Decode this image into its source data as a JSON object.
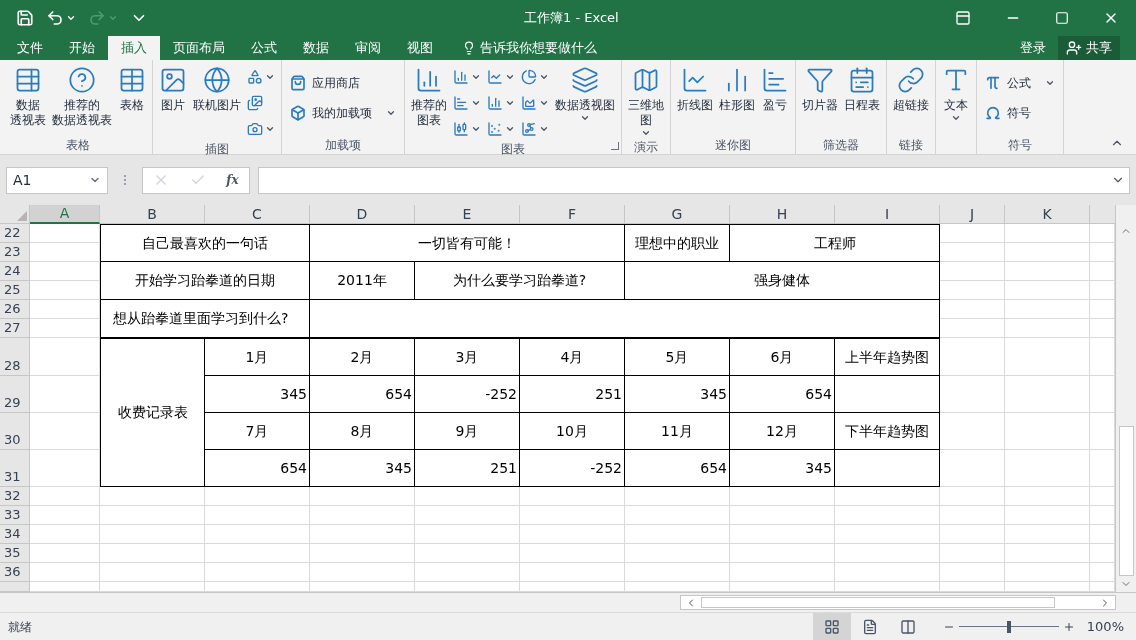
{
  "window": {
    "title": "工作簿1 - Excel"
  },
  "quick_access": [
    {
      "kind": "save",
      "disabled": false
    },
    {
      "kind": "undo",
      "disabled": false
    },
    {
      "kind": "redo",
      "disabled": true
    },
    {
      "kind": "customize",
      "disabled": false
    }
  ],
  "tabs": [
    {
      "label": "文件",
      "selected": false
    },
    {
      "label": "开始",
      "selected": false
    },
    {
      "label": "插入",
      "selected": true
    },
    {
      "label": "页面布局",
      "selected": false
    },
    {
      "label": "公式",
      "selected": false
    },
    {
      "label": "数据",
      "selected": false
    },
    {
      "label": "审阅",
      "selected": false
    },
    {
      "label": "视图",
      "selected": false
    }
  ],
  "tell_me": {
    "placeholder": "告诉我你想要做什么"
  },
  "account": {
    "sign_in": "登录",
    "share": "共享"
  },
  "ribbon": [
    {
      "label": "表格",
      "items": [
        {
          "kind": "large",
          "lines": [
            "数据",
            "透视表"
          ]
        },
        {
          "kind": "large",
          "lines": [
            "推荐的",
            "数据透视表"
          ]
        },
        {
          "kind": "large",
          "lines": [
            "表格"
          ]
        }
      ]
    },
    {
      "label": "插图",
      "items": [
        {
          "kind": "large",
          "lines": [
            "图片"
          ]
        },
        {
          "kind": "large",
          "lines": [
            "联机图片"
          ]
        },
        {
          "kind": "icon",
          "caret": true
        },
        {
          "kind": "icon"
        },
        {
          "kind": "icon",
          "caret": true
        }
      ]
    },
    {
      "label": "加载项",
      "items": [
        {
          "kind": "small",
          "label": "应用商店"
        },
        {
          "kind": "small",
          "label": "我的加载项",
          "caret": true
        }
      ]
    },
    {
      "label": "图表",
      "launcher": true,
      "items": [
        {
          "kind": "large",
          "lines": [
            "推荐的",
            "图表"
          ]
        },
        {
          "kind": "icon",
          "caret": true
        },
        {
          "kind": "icon",
          "caret": true
        },
        {
          "kind": "icon",
          "caret": true
        },
        {
          "kind": "icon",
          "caret": true
        },
        {
          "kind": "icon",
          "caret": true
        },
        {
          "kind": "icon",
          "caret": true
        },
        {
          "kind": "icon",
          "caret": true
        },
        {
          "kind": "icon",
          "caret": true
        },
        {
          "kind": "icon",
          "caret": true
        },
        {
          "kind": "large",
          "lines": [
            "数据透视图"
          ],
          "caret": true
        }
      ]
    },
    {
      "label": "演示",
      "items": [
        {
          "kind": "large",
          "lines": [
            "三维地",
            "图"
          ],
          "caret": true
        }
      ]
    },
    {
      "label": "迷你图",
      "items": [
        {
          "kind": "large",
          "lines": [
            "折线图"
          ]
        },
        {
          "kind": "large",
          "lines": [
            "柱形图"
          ]
        },
        {
          "kind": "large",
          "lines": [
            "盈亏"
          ]
        }
      ]
    },
    {
      "label": "筛选器",
      "items": [
        {
          "kind": "large",
          "lines": [
            "切片器"
          ]
        },
        {
          "kind": "large",
          "lines": [
            "日程表"
          ]
        }
      ]
    },
    {
      "label": "链接",
      "items": [
        {
          "kind": "large",
          "lines": [
            "超链接"
          ]
        }
      ]
    },
    {
      "items": [
        {
          "kind": "large",
          "lines": [
            "文本"
          ],
          "caret": true
        }
      ]
    },
    {
      "label": "符号",
      "items": [
        {
          "kind": "small",
          "label": "公式",
          "caret": true
        },
        {
          "kind": "small",
          "label": "符号"
        }
      ]
    }
  ],
  "formula_bar": {
    "name_box": "A1",
    "function_label": "fx"
  },
  "sheet": {
    "columns": [
      {
        "label": "A",
        "selected": true
      },
      {
        "label": "B",
        "selected": false
      },
      {
        "label": "C",
        "selected": false
      },
      {
        "label": "D",
        "selected": false
      },
      {
        "label": "E",
        "selected": false
      },
      {
        "label": "F",
        "selected": false
      },
      {
        "label": "G",
        "selected": false
      },
      {
        "label": "H",
        "selected": false
      },
      {
        "label": "I",
        "selected": false
      },
      {
        "label": "J",
        "selected": false
      },
      {
        "label": "K",
        "selected": false
      }
    ],
    "rows": [
      "22",
      "23",
      "24",
      "25",
      "26",
      "27",
      "28",
      "29",
      "30",
      "31",
      "32",
      "33",
      "34",
      "35",
      "36"
    ],
    "table": [
      {
        "cells": [
          {
            "kind": "text",
            "text": "自己最喜欢的一句话"
          },
          {
            "kind": "text",
            "text": "一切皆有可能！"
          },
          {
            "kind": "text",
            "text": "理想中的职业"
          },
          {
            "kind": "text",
            "text": "工程师"
          }
        ]
      },
      {
        "cells": [
          {
            "kind": "text",
            "text": "开始学习跆拳道的日期"
          },
          {
            "kind": "text",
            "text": "2011年"
          },
          {
            "kind": "text",
            "text": "为什么要学习跆拳道?"
          },
          {
            "kind": "text",
            "text": "强身健体"
          }
        ]
      },
      {
        "cells": [
          {
            "kind": "prompt",
            "text": "想从跆拳道里面学习到什么?"
          },
          {
            "kind": "blank"
          }
        ]
      },
      {
        "cells": [
          {
            "kind": "text",
            "text": "收费记录表"
          },
          {
            "kind": "text",
            "text": "1月"
          },
          {
            "kind": "text",
            "text": "2月"
          },
          {
            "kind": "text",
            "text": "3月"
          },
          {
            "kind": "text",
            "text": "4月"
          },
          {
            "kind": "text",
            "text": "5月"
          },
          {
            "kind": "text",
            "text": "6月"
          },
          {
            "kind": "text",
            "text": "上半年趋势图"
          },
          {
            "kind": "number",
            "text": "345"
          },
          {
            "kind": "number",
            "text": "654"
          },
          {
            "kind": "number",
            "text": "-252"
          },
          {
            "kind": "number",
            "text": "251"
          },
          {
            "kind": "number",
            "text": "345"
          },
          {
            "kind": "number",
            "text": "654"
          },
          {
            "kind": "blank"
          },
          {
            "kind": "text",
            "text": "7月"
          },
          {
            "kind": "text",
            "text": "8月"
          },
          {
            "kind": "text",
            "text": "9月"
          },
          {
            "kind": "text",
            "text": "10月"
          },
          {
            "kind": "text",
            "text": "11月"
          },
          {
            "kind": "text",
            "text": "12月"
          },
          {
            "kind": "text",
            "text": "下半年趋势图"
          },
          {
            "kind": "number",
            "text": "654"
          },
          {
            "kind": "number",
            "text": "345"
          },
          {
            "kind": "number",
            "text": "251"
          },
          {
            "kind": "number",
            "text": "-252"
          },
          {
            "kind": "number",
            "text": "654"
          },
          {
            "kind": "number",
            "text": "345"
          },
          {
            "kind": "blank"
          }
        ]
      }
    ]
  },
  "status_bar": {
    "status": "就绪",
    "views": [
      {
        "kind": "normal",
        "selected": true
      },
      {
        "kind": "page_layout",
        "selected": false
      },
      {
        "kind": "page_break",
        "selected": false
      }
    ],
    "zoom": {
      "level": 0.5,
      "reading": "100%"
    }
  }
}
